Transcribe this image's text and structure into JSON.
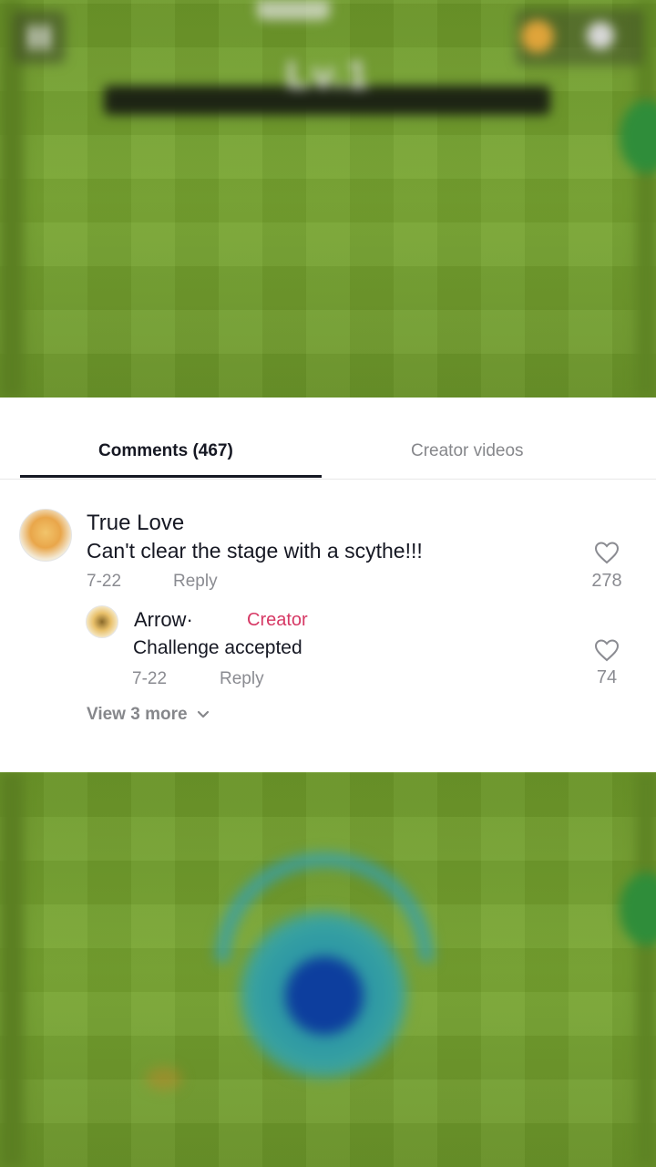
{
  "game": {
    "level_text": "Lv.1"
  },
  "tabs": {
    "comments_label": "Comments (467)",
    "creator_videos_label": "Creator videos"
  },
  "comment": {
    "username": "True Love",
    "text": "Can't clear the stage with a scythe!!!",
    "date": "7-22",
    "reply_label": "Reply",
    "likes": "278"
  },
  "reply": {
    "username": "Arrow·",
    "badge": "Creator",
    "text": "Challenge accepted",
    "date": "7-22",
    "reply_label": "Reply",
    "likes": "74"
  },
  "view_more_label": "View 3 more",
  "icons": {
    "like": "heart-outline-icon",
    "expand": "chevron-down-icon"
  },
  "colors": {
    "creator_badge": "#d63864",
    "muted_text": "#8a8b91",
    "primary_text": "#161823"
  }
}
